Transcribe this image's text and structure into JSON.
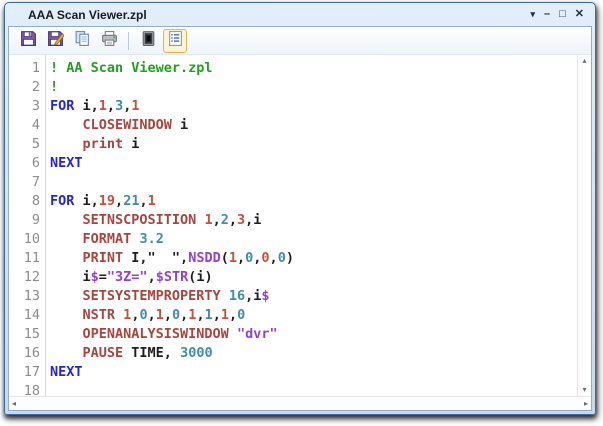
{
  "window": {
    "title": "AAA Scan Viewer.zpl",
    "controls": [
      {
        "name": "window-menu",
        "glyph": "▾"
      },
      {
        "name": "minimize",
        "glyph": "–"
      },
      {
        "name": "maximize",
        "glyph": "□"
      },
      {
        "name": "close",
        "glyph": "✕"
      }
    ]
  },
  "toolbar": {
    "buttons": [
      {
        "name": "save",
        "icon": "floppy-disk"
      },
      {
        "name": "save-as",
        "icon": "floppy-disk-pencil"
      },
      {
        "name": "copy",
        "icon": "copy-pages"
      },
      {
        "name": "print",
        "icon": "printer"
      },
      {
        "name": "invert-display",
        "icon": "dark-frame"
      },
      {
        "name": "line-numbers",
        "icon": "numbered-list",
        "active": true
      }
    ]
  },
  "icons": {
    "scroll_up": "▴",
    "scroll_down": "▾",
    "scroll_left": "◂",
    "scroll_right": "▸"
  },
  "colors": {
    "comment": "#21a021",
    "keyword": "#2424e0",
    "command": "#a8453d",
    "number_red": "#c8503c",
    "number_teal": "#3f8cad",
    "string_function": "#9340d4",
    "plain_text": "#1e1e1e",
    "line_number": "#8c8c8c",
    "titlebar": "#d3e3f5",
    "active_button_border": "#e2b44e"
  },
  "editor": {
    "lines": [
      {
        "num": "1",
        "segs": [
          [
            "com",
            "! AA Scan Viewer.zpl"
          ]
        ]
      },
      {
        "num": "2",
        "segs": [
          [
            "com",
            "!"
          ]
        ]
      },
      {
        "num": "3",
        "segs": [
          [
            "kw",
            "FOR"
          ],
          [
            "pln",
            " i,"
          ],
          [
            "n1",
            "1"
          ],
          [
            "pln",
            ","
          ],
          [
            "n2",
            "3"
          ],
          [
            "pln",
            ","
          ],
          [
            "n1",
            "1"
          ]
        ]
      },
      {
        "num": "4",
        "segs": [
          [
            "pln",
            "    "
          ],
          [
            "cmd",
            "CLOSEWINDOW"
          ],
          [
            "pln",
            " i"
          ]
        ]
      },
      {
        "num": "5",
        "segs": [
          [
            "pln",
            "    "
          ],
          [
            "cmd",
            "print"
          ],
          [
            "pln",
            " i"
          ]
        ]
      },
      {
        "num": "6",
        "segs": [
          [
            "kw",
            "NEXT"
          ]
        ]
      },
      {
        "num": "7",
        "segs": []
      },
      {
        "num": "8",
        "segs": [
          [
            "kw",
            "FOR"
          ],
          [
            "pln",
            " i,"
          ],
          [
            "n1",
            "19"
          ],
          [
            "pln",
            ","
          ],
          [
            "n2",
            "21"
          ],
          [
            "pln",
            ","
          ],
          [
            "n1",
            "1"
          ]
        ]
      },
      {
        "num": "9",
        "segs": [
          [
            "pln",
            "    "
          ],
          [
            "cmd",
            "SETNSCPOSITION"
          ],
          [
            "pln",
            " "
          ],
          [
            "n1",
            "1"
          ],
          [
            "pln",
            ","
          ],
          [
            "n2",
            "2"
          ],
          [
            "pln",
            ","
          ],
          [
            "n1",
            "3"
          ],
          [
            "pln",
            ",i"
          ]
        ]
      },
      {
        "num": "10",
        "segs": [
          [
            "pln",
            "    "
          ],
          [
            "cmd",
            "FORMAT"
          ],
          [
            "pln",
            " "
          ],
          [
            "n2",
            "3.2"
          ]
        ]
      },
      {
        "num": "11",
        "segs": [
          [
            "pln",
            "    "
          ],
          [
            "cmd",
            "PRINT"
          ],
          [
            "pln",
            " I,\"  \","
          ],
          [
            "pur",
            "NSDD"
          ],
          [
            "pln",
            "("
          ],
          [
            "n1",
            "1"
          ],
          [
            "pln",
            ","
          ],
          [
            "n2",
            "0"
          ],
          [
            "pln",
            ","
          ],
          [
            "n1",
            "0"
          ],
          [
            "pln",
            ","
          ],
          [
            "n2",
            "0"
          ],
          [
            "pln",
            ")"
          ]
        ]
      },
      {
        "num": "12",
        "segs": [
          [
            "pln",
            "    i"
          ],
          [
            "pur",
            "$"
          ],
          [
            "pln",
            "="
          ],
          [
            "pur",
            "\"3Z=\""
          ],
          [
            "pln",
            ","
          ],
          [
            "pur",
            "$STR"
          ],
          [
            "pln",
            "(i)"
          ]
        ]
      },
      {
        "num": "13",
        "segs": [
          [
            "pln",
            "    "
          ],
          [
            "cmd",
            "SETSYSTEMPROPERTY"
          ],
          [
            "pln",
            " "
          ],
          [
            "n2",
            "16"
          ],
          [
            "pln",
            ",i"
          ],
          [
            "pur",
            "$"
          ]
        ]
      },
      {
        "num": "14",
        "segs": [
          [
            "pln",
            "    "
          ],
          [
            "cmd",
            "NSTR"
          ],
          [
            "pln",
            " "
          ],
          [
            "n1",
            "1"
          ],
          [
            "pln",
            ","
          ],
          [
            "n2",
            "0"
          ],
          [
            "pln",
            ","
          ],
          [
            "n1",
            "1"
          ],
          [
            "pln",
            ","
          ],
          [
            "n2",
            "0"
          ],
          [
            "pln",
            ","
          ],
          [
            "n1",
            "1"
          ],
          [
            "pln",
            ","
          ],
          [
            "n2",
            "1"
          ],
          [
            "pln",
            ","
          ],
          [
            "n1",
            "1"
          ],
          [
            "pln",
            ","
          ],
          [
            "n2",
            "0"
          ]
        ]
      },
      {
        "num": "15",
        "segs": [
          [
            "pln",
            "    "
          ],
          [
            "cmd",
            "OPENANALYSISWINDOW"
          ],
          [
            "pln",
            " "
          ],
          [
            "pur",
            "\"dvr\""
          ]
        ]
      },
      {
        "num": "16",
        "segs": [
          [
            "pln",
            "    "
          ],
          [
            "cmd",
            "PAUSE"
          ],
          [
            "pln",
            " TIME, "
          ],
          [
            "n2",
            "3000"
          ]
        ]
      },
      {
        "num": "17",
        "segs": [
          [
            "kw",
            "NEXT"
          ]
        ]
      },
      {
        "num": "18",
        "segs": []
      }
    ]
  }
}
